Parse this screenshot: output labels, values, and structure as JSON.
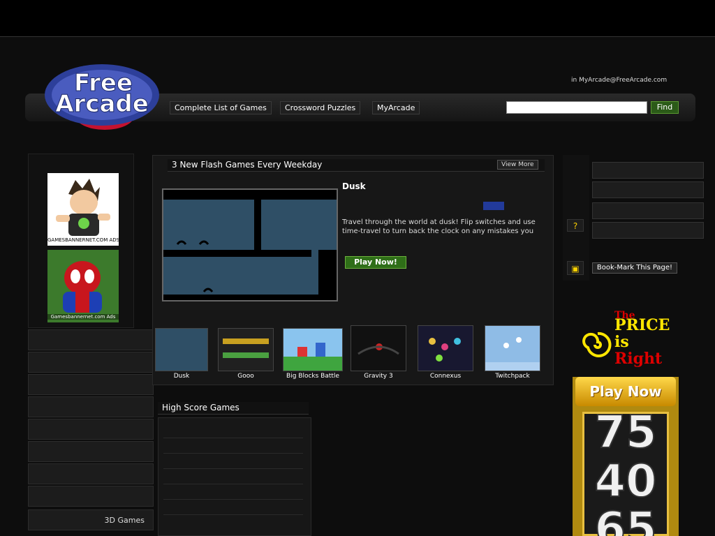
{
  "nav": {
    "complete_list": "Complete List of Games",
    "crossword": "Crossword Puzzles",
    "myarcade": "MyArcade",
    "find": "Find",
    "email": "in MyArcade@FreeArcade.com"
  },
  "ads": {
    "label1": "GAMESBANNERNET.COM ADS",
    "label2": "Gamesbannernet.com Ads"
  },
  "featured": {
    "heading": "3 New Flash Games Every Weekday",
    "view_more": "View More",
    "title": "Dusk",
    "description": "Travel through the world at dusk! Flip switches and use time-travel to turn back the clock on any mistakes you",
    "play": "Play Now!"
  },
  "thumbs": [
    {
      "label": "Dusk"
    },
    {
      "label": "Gooo"
    },
    {
      "label": "Big Blocks Battle"
    },
    {
      "label": "Gravity 3"
    },
    {
      "label": "Connexus"
    },
    {
      "label": "Twitchpack"
    }
  ],
  "highscore": {
    "heading": "High Score Games"
  },
  "sidebar": {
    "last_item": "3D Games"
  },
  "right": {
    "bookmark": "Book-Mark This Page!"
  },
  "promo": {
    "line1": "The",
    "line2": "PRICE",
    "line3": "is",
    "line4": "Right",
    "play": "Play Now",
    "n1": "75",
    "n2": "40",
    "n3": "65"
  },
  "colors": {
    "accent": "#ffd200",
    "nav_bg": "#1e1e1e"
  }
}
